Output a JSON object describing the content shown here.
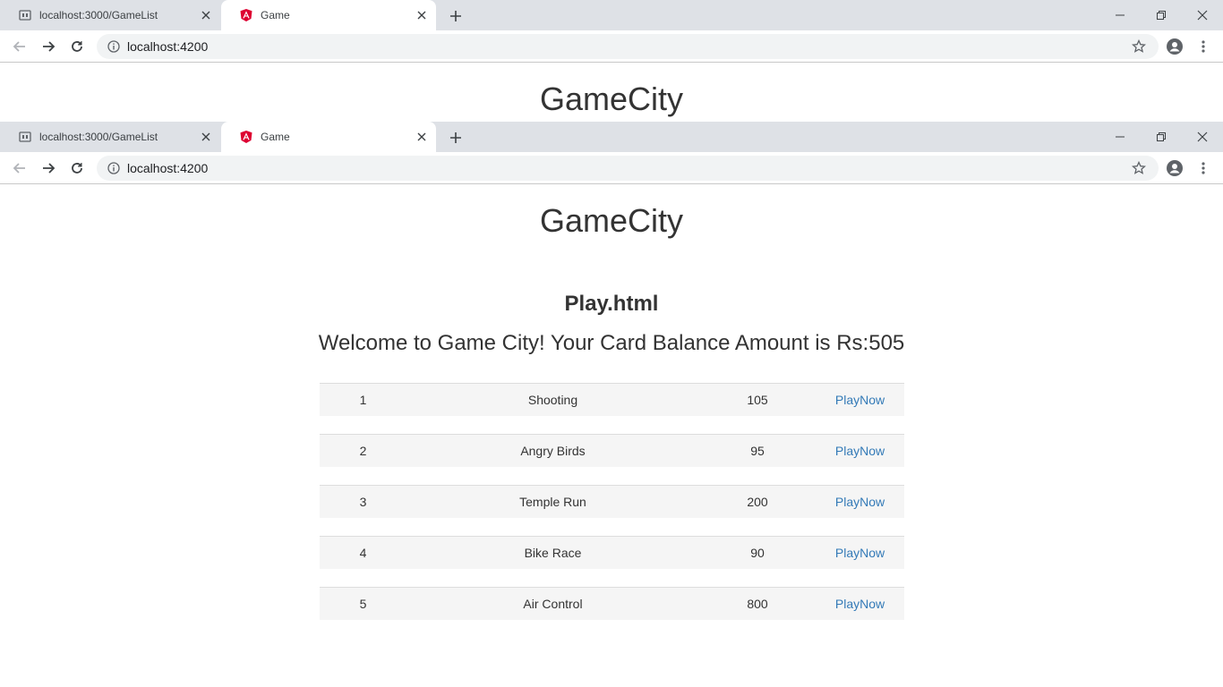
{
  "browser": {
    "tabs": [
      {
        "title": "localhost:3000/GameList",
        "active": false
      },
      {
        "title": "Game",
        "active": true
      }
    ],
    "url": "localhost:4200"
  },
  "page": {
    "brand": "GameCity",
    "heading": "Play.html",
    "welcome": "Welcome to Game City! Your Card Balance Amount is Rs:505",
    "games": [
      {
        "id": "1",
        "name": "Shooting",
        "price": "105",
        "action": "PlayNow"
      },
      {
        "id": "2",
        "name": "Angry Birds",
        "price": "95",
        "action": "PlayNow"
      },
      {
        "id": "3",
        "name": "Temple Run",
        "price": "200",
        "action": "PlayNow"
      },
      {
        "id": "4",
        "name": "Bike Race",
        "price": "90",
        "action": "PlayNow"
      },
      {
        "id": "5",
        "name": "Air Control",
        "price": "800",
        "action": "PlayNow"
      }
    ]
  },
  "colors": {
    "link": "#337ab7",
    "tabstrip": "#dee1e6",
    "angular_red": "#dd0031"
  }
}
